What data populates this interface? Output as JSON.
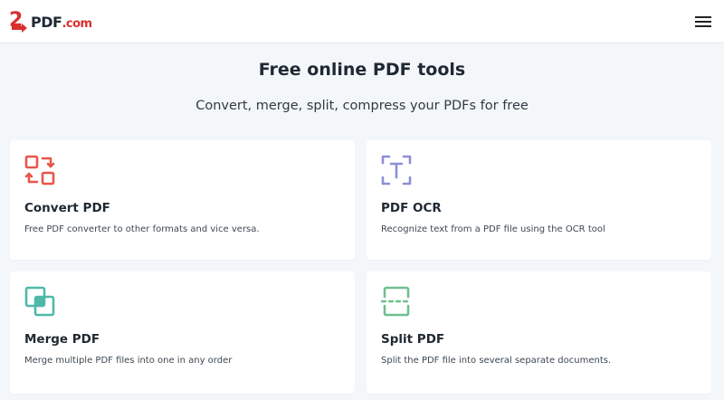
{
  "header": {
    "logo_prefix": "2",
    "logo_text": "PDF",
    "logo_domain": ".com",
    "menu_icon": "hamburger-menu-icon"
  },
  "main": {
    "title": "Free online PDF tools",
    "subtitle": "Convert, merge, split, compress your PDFs for free"
  },
  "tools": [
    {
      "title": "Convert PDF",
      "description": "Free PDF converter to other formats and vice versa.",
      "icon": "convert-icon",
      "color": "#e8564a"
    },
    {
      "title": "PDF OCR",
      "description": "Recognize text from a PDF file using the OCR tool",
      "icon": "ocr-icon",
      "color": "#8e8fd6"
    },
    {
      "title": "Merge PDF",
      "description": "Merge multiple PDF files into one in any order",
      "icon": "merge-icon",
      "color": "#4fb9a9"
    },
    {
      "title": "Split PDF",
      "description": "Split the PDF file into several separate documents.",
      "icon": "split-icon",
      "color": "#6fbf8f"
    }
  ],
  "colors": {
    "brand_red": "#d9302c",
    "brand_dark": "#1f2933",
    "background": "#f4f7fa"
  }
}
